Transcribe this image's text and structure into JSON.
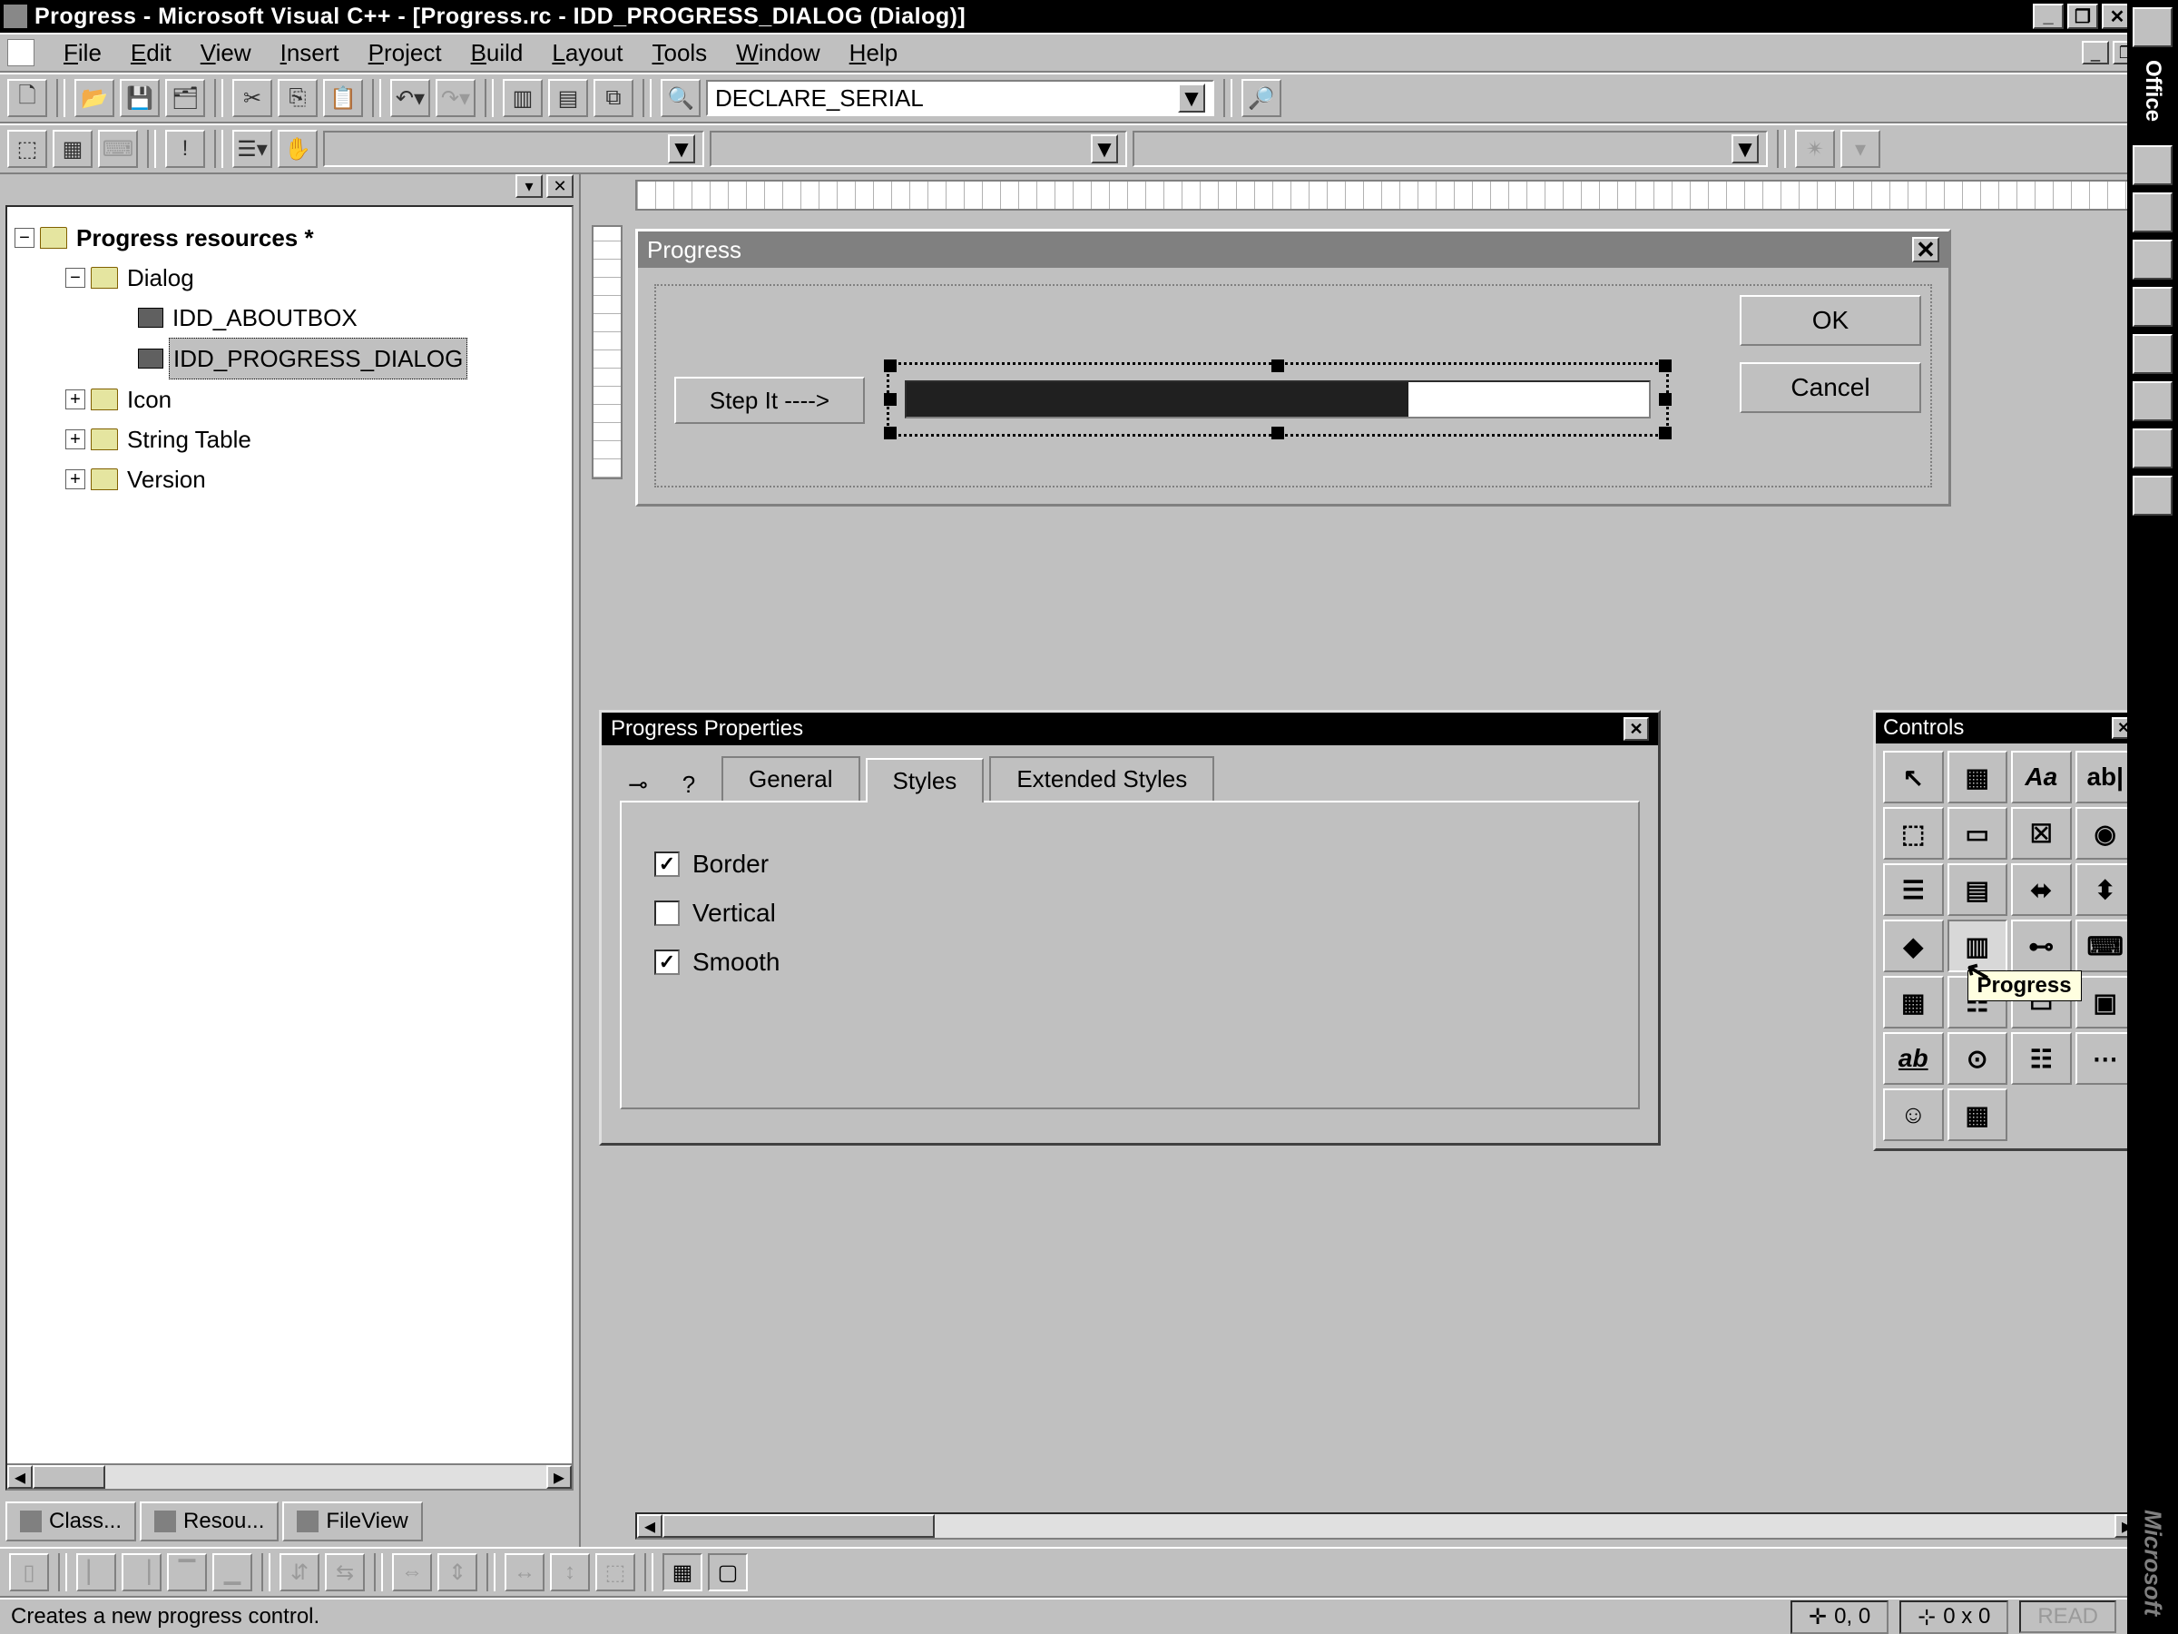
{
  "titlebar": {
    "title": "Progress - Microsoft Visual C++ - [Progress.rc - IDD_PROGRESS_DIALOG (Dialog)]"
  },
  "menubar": {
    "items": [
      {
        "label": "File",
        "ul": "F"
      },
      {
        "label": "Edit",
        "ul": "E"
      },
      {
        "label": "View",
        "ul": "V"
      },
      {
        "label": "Insert",
        "ul": "I"
      },
      {
        "label": "Project",
        "ul": "P"
      },
      {
        "label": "Build",
        "ul": "B"
      },
      {
        "label": "Layout",
        "ul": "L"
      },
      {
        "label": "Tools",
        "ul": "T"
      },
      {
        "label": "Window",
        "ul": "W"
      },
      {
        "label": "Help",
        "ul": "H"
      }
    ]
  },
  "toolbar1": {
    "find_combo": "DECLARE_SERIAL"
  },
  "tree": {
    "root": "Progress resources *",
    "dialog": "Dialog",
    "aboutbox": "IDD_ABOUTBOX",
    "progress_dialog": "IDD_PROGRESS_DIALOG",
    "icon": "Icon",
    "string_table": "String Table",
    "version": "Version"
  },
  "left_tabs": {
    "class": "Class...",
    "resource": "Resou...",
    "fileview": "FileView"
  },
  "dialog": {
    "title": "Progress",
    "step_it": "Step It ---->",
    "ok": "OK",
    "cancel": "Cancel"
  },
  "properties": {
    "title": "Progress Properties",
    "tabs": {
      "general": "General",
      "styles": "Styles",
      "extended": "Extended Styles"
    },
    "checks": {
      "border": "Border",
      "vertical": "Vertical",
      "smooth": "Smooth"
    },
    "border_checked": true,
    "vertical_checked": false,
    "smooth_checked": true
  },
  "toolbox": {
    "title": "Controls",
    "tooltip": "Progress"
  },
  "office": {
    "label": "Office",
    "brand": "Microsoft"
  },
  "statusbar": {
    "message": "Creates a new progress control.",
    "pos": "0, 0",
    "size": "0 x 0",
    "read": "READ"
  }
}
